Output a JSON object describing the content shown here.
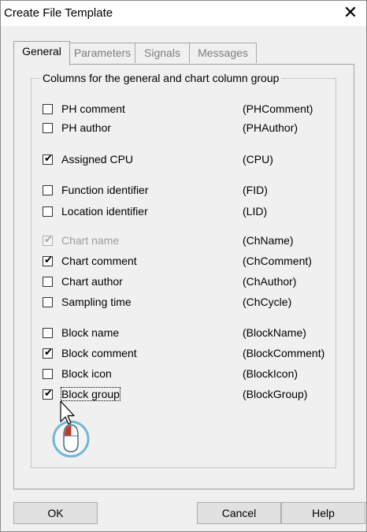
{
  "dialog": {
    "title": "Create File Template",
    "close_glyph": "✕"
  },
  "tabs": [
    {
      "label": "General",
      "active": true
    },
    {
      "label": "Parameters",
      "active": false
    },
    {
      "label": "Signals",
      "active": false
    },
    {
      "label": "Messages",
      "active": false
    }
  ],
  "group": {
    "legend": "Columns for the general and chart column group",
    "items": [
      {
        "label": "PH comment",
        "code": "(PHComment)",
        "checked": false,
        "enabled": true
      },
      {
        "label": "PH author",
        "code": "(PHAuthor)",
        "checked": false,
        "enabled": true
      },
      {
        "label": "Assigned CPU",
        "code": "(CPU)",
        "checked": true,
        "enabled": true
      },
      {
        "label": "Function identifier",
        "code": "(FID)",
        "checked": false,
        "enabled": true
      },
      {
        "label": "Location identifier",
        "code": "(LID)",
        "checked": false,
        "enabled": true
      },
      {
        "label": "Chart name",
        "code": "(ChName)",
        "checked": true,
        "enabled": false
      },
      {
        "label": "Chart comment",
        "code": "(ChComment)",
        "checked": true,
        "enabled": true
      },
      {
        "label": "Chart author",
        "code": "(ChAuthor)",
        "checked": false,
        "enabled": true
      },
      {
        "label": "Sampling time",
        "code": "(ChCycle)",
        "checked": false,
        "enabled": true
      },
      {
        "label": "Block name",
        "code": "(BlockName)",
        "checked": false,
        "enabled": true
      },
      {
        "label": "Block comment",
        "code": "(BlockComment)",
        "checked": true,
        "enabled": true
      },
      {
        "label": "Block icon",
        "code": "(BlockIcon)",
        "checked": false,
        "enabled": true
      },
      {
        "label": "Block group",
        "code": "(BlockGroup)",
        "checked": true,
        "enabled": true,
        "focused": true
      }
    ]
  },
  "buttons": {
    "ok": "OK",
    "cancel": "Cancel",
    "help": "Help"
  },
  "check_glyph": "✔",
  "colors": {
    "cursor_accent": "#c0392b",
    "cursor_ring": "#6fb8d9"
  },
  "icons": {
    "cursor": "mouse-click-cursor-icon"
  }
}
